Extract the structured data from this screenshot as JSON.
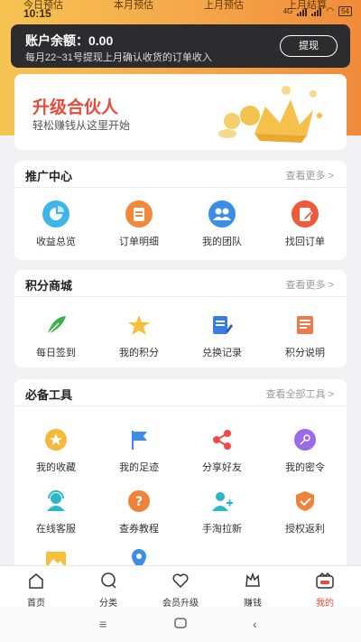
{
  "status": {
    "time": "10:15",
    "tabs": [
      "今日预估",
      "本月预估",
      "上月预估",
      "上月结算"
    ],
    "network": "4G",
    "battery": "54"
  },
  "balance": {
    "label": "账户余额：0.00",
    "note": "每月22~31号提现上月确认收货的订单收入",
    "withdraw": "提现"
  },
  "promo": {
    "title": "升级合伙人",
    "subtitle": "轻松赚钱从这里开始"
  },
  "promotion_center": {
    "title": "推广中心",
    "more": "查看更多 >",
    "items": [
      {
        "label": "收益总览",
        "icon": "earnings-chart-icon"
      },
      {
        "label": "订单明细",
        "icon": "order-detail-icon"
      },
      {
        "label": "我的团队",
        "icon": "team-icon"
      },
      {
        "label": "找回订单",
        "icon": "retrieve-order-icon"
      }
    ]
  },
  "points_mall": {
    "title": "积分商城",
    "more": "查看更多 >",
    "items": [
      {
        "label": "每日签到",
        "icon": "feather-sign-in-icon"
      },
      {
        "label": "我的积分",
        "icon": "star-icon"
      },
      {
        "label": "兑换记录",
        "icon": "exchange-record-icon"
      },
      {
        "label": "积分说明",
        "icon": "points-description-icon"
      }
    ]
  },
  "tools": {
    "title": "必备工具",
    "more": "查看全部工具 >",
    "items": [
      {
        "label": "我的收藏",
        "icon": "favorite-star-icon"
      },
      {
        "label": "我的足迹",
        "icon": "footprint-flag-icon"
      },
      {
        "label": "分享好友",
        "icon": "share-icon"
      },
      {
        "label": "我的密令",
        "icon": "key-icon"
      },
      {
        "label": "在线客服",
        "icon": "customer-service-icon"
      },
      {
        "label": "查券教程",
        "icon": "help-icon"
      },
      {
        "label": "手淘拉新",
        "icon": "add-user-icon"
      },
      {
        "label": "授权返利",
        "icon": "authorize-shield-icon"
      }
    ]
  },
  "tabbar": {
    "items": [
      {
        "label": "首页",
        "icon": "home-icon"
      },
      {
        "label": "分类",
        "icon": "category-icon"
      },
      {
        "label": "会员升级",
        "icon": "heart-icon"
      },
      {
        "label": "赚钱",
        "icon": "crown-icon"
      },
      {
        "label": "我的",
        "icon": "profile-icon"
      }
    ],
    "active": "我的"
  },
  "colors": {
    "accent": "#e94a3a",
    "header_gradient_start": "#f6c453",
    "header_gradient_end": "#f08a3a",
    "balance_bg": "#2c2c2e"
  }
}
